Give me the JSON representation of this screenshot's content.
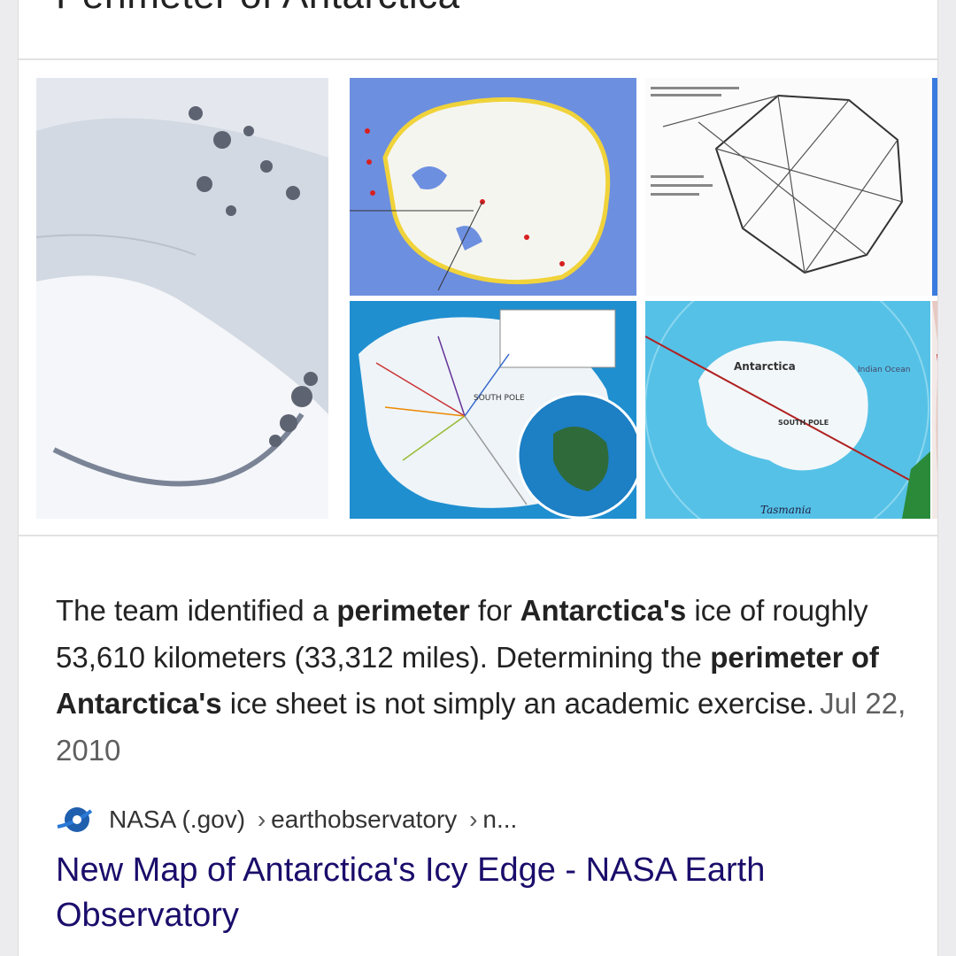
{
  "header": {
    "title": "Perimeter of Antarctica"
  },
  "images": {
    "thumbs": [
      {
        "name": "satellite-ice-image",
        "icon": "satellite-photo"
      },
      {
        "name": "antarctica-coast-map",
        "icon": "map"
      },
      {
        "name": "nautical-miles-diagram",
        "icon": "diagram"
      },
      {
        "name": "antarctica-flight-routes-map",
        "icon": "map",
        "text": {
          "pole": "SOUTH POLE"
        }
      },
      {
        "name": "antarctica-ocean-map",
        "icon": "map",
        "text": {
          "name": "Antarctica",
          "pole": "SOUTH POLE",
          "ocean": "Indian Ocean",
          "place": "Tasmania"
        }
      },
      {
        "name": "partial-blue-thumbnail",
        "icon": "image"
      },
      {
        "name": "partial-red-thumbnail",
        "icon": "image"
      }
    ]
  },
  "snippet": {
    "t1": "The team identified a ",
    "b1": "perimeter",
    "t2": " for ",
    "b2": "Antarctica's",
    "t3": " ice of roughly 53,610 kilometers (33,312 miles). Determining the ",
    "b3": "perimeter of Antarctica's",
    "t4": " ice sheet is not simply an academic exercise.",
    "date": "Jul 22, 2010"
  },
  "source": {
    "site": "NASA (.gov)",
    "separator": "›",
    "path1": "earthobservatory",
    "path2": "n..."
  },
  "result": {
    "title": "New Map of Antarctica's Icy Edge - NASA Earth Observatory",
    "link_color": "#1a0d6b"
  }
}
